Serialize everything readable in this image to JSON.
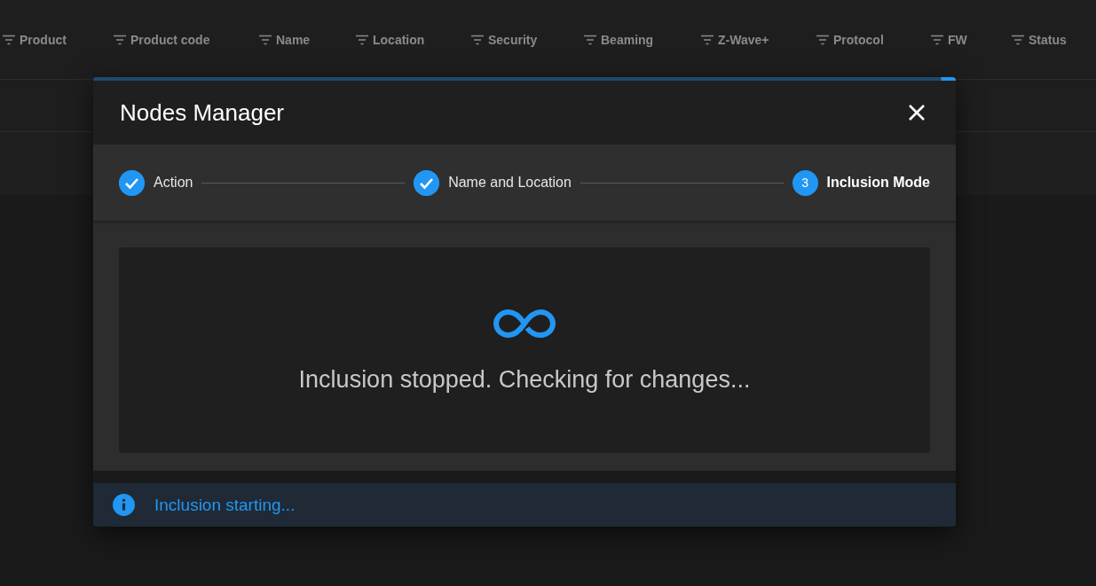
{
  "table": {
    "columns": [
      "Product",
      "Product code",
      "Name",
      "Location",
      "Security",
      "Beaming",
      "Z-Wave+",
      "Protocol",
      "FW",
      "Status"
    ]
  },
  "dialog": {
    "title": "Nodes Manager",
    "progress": {
      "level": 0.017
    },
    "steps": [
      {
        "label": "Action",
        "completed": true
      },
      {
        "label": "Name and Location",
        "completed": true
      },
      {
        "number": "3",
        "label": "Inclusion Mode",
        "completed": false
      }
    ],
    "message": "Inclusion stopped. Checking for changes...",
    "alert": {
      "kind": "info",
      "text": "Inclusion starting..."
    }
  }
}
